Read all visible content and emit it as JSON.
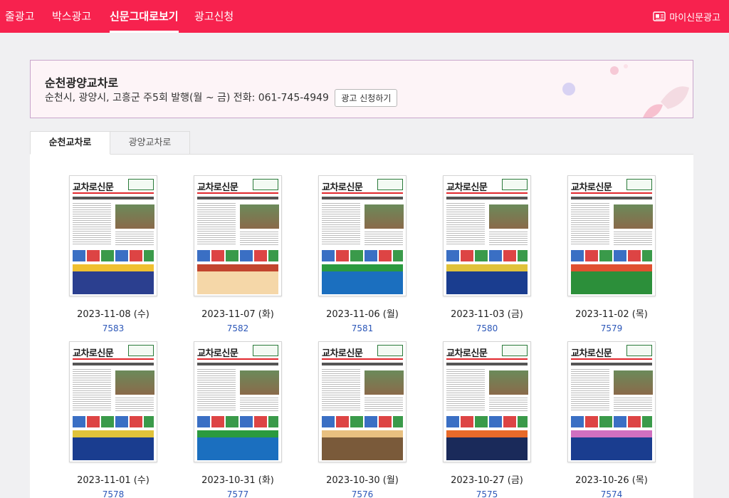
{
  "nav": {
    "items": [
      {
        "label": "줄광고"
      },
      {
        "label": "박스광고"
      },
      {
        "label": "신문그대로보기",
        "active": true
      },
      {
        "label": "광고신청"
      }
    ],
    "my_label": "마이신문광고"
  },
  "info": {
    "title": "순천광양교차로",
    "description": "순천시, 광양시, 고흥군 주5회 발행(월 ~ 금) 전화: 061-745-4949",
    "apply_button": "광고 신청하기"
  },
  "tabs": [
    {
      "label": "순천교차로",
      "active": true
    },
    {
      "label": "광양교차로",
      "active": false
    }
  ],
  "issues": [
    {
      "date": "2023-11-08 (수)",
      "number": "7583"
    },
    {
      "date": "2023-11-07 (화)",
      "number": "7582"
    },
    {
      "date": "2023-11-06 (월)",
      "number": "7581"
    },
    {
      "date": "2023-11-03 (금)",
      "number": "7580"
    },
    {
      "date": "2023-11-02 (목)",
      "number": "7579"
    },
    {
      "date": "2023-11-01 (수)",
      "number": "7578"
    },
    {
      "date": "2023-10-31 (화)",
      "number": "7577"
    },
    {
      "date": "2023-10-30 (월)",
      "number": "7576"
    },
    {
      "date": "2023-10-27 (금)",
      "number": "7575"
    },
    {
      "date": "2023-10-26 (목)",
      "number": "7574"
    }
  ],
  "masthead": "교차로신문",
  "colors": {
    "brand": "#f7224e",
    "link": "#2c57b8"
  }
}
